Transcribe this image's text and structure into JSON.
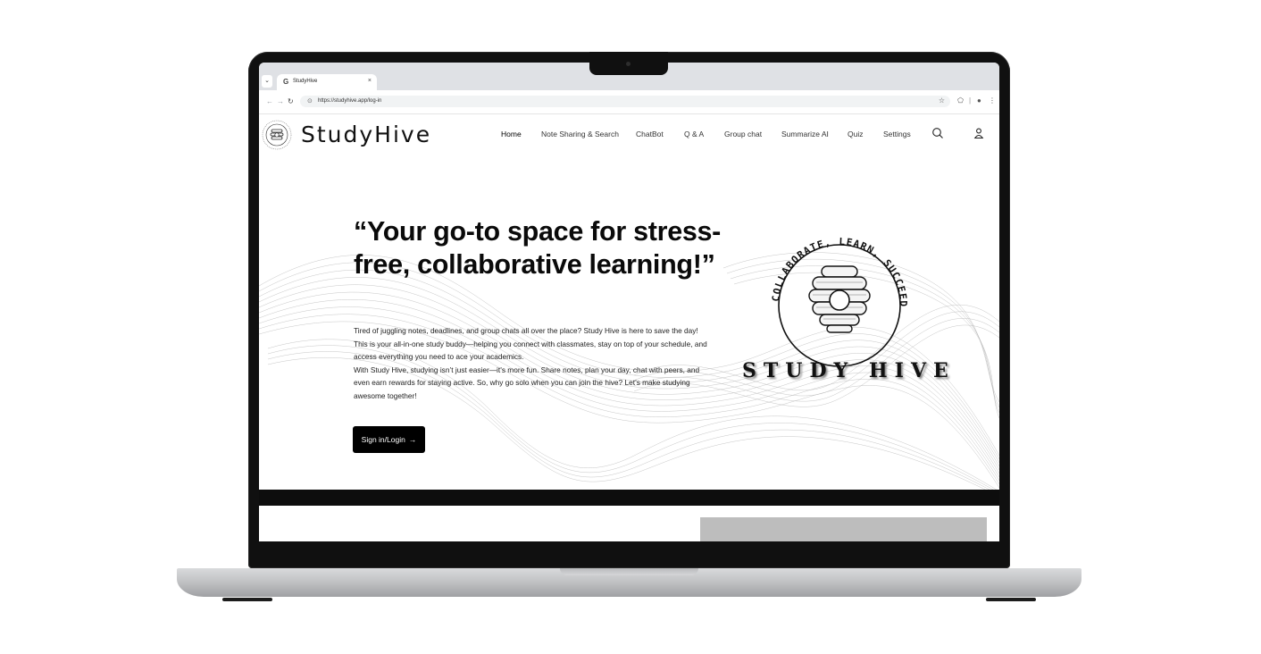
{
  "browser": {
    "tab_title": "StudyHive",
    "tab_favicon": "G",
    "tab_close": "×",
    "url": "https://studyhive.app/log-in"
  },
  "site": {
    "brand_name": "StudyHive",
    "nav": [
      {
        "label": "Home",
        "active": true
      },
      {
        "label": "Note Sharing & Search"
      },
      {
        "label": "ChatBot"
      },
      {
        "label": "Q & A"
      },
      {
        "label": "Group chat"
      },
      {
        "label": "Summarize AI"
      },
      {
        "label": "Quiz"
      },
      {
        "label": "Settings"
      }
    ]
  },
  "hero": {
    "title": "“Your go-to space for stress-free, collaborative learning!”",
    "paragraph_1": "Tired of juggling notes, deadlines, and group chats all over the place? Study Hive is here to save the day! This is your all-in-one study buddy—helping you connect with classmates, stay on top of your schedule, and access everything you need to ace your academics.",
    "paragraph_2": "With Study Hive, studying isn’t just easier—it’s more fun. Share notes, plan your day, chat with peers, and even earn rewards for staying active. So, why go solo when you can join the hive? Let’s make studying awesome together!",
    "cta_label": "Sign in/Login",
    "cta_arrow": "→",
    "logo_arc_text": "COLLABORATE, LEARN, SUCCEED",
    "logo_name": "STUDY HIVE"
  }
}
